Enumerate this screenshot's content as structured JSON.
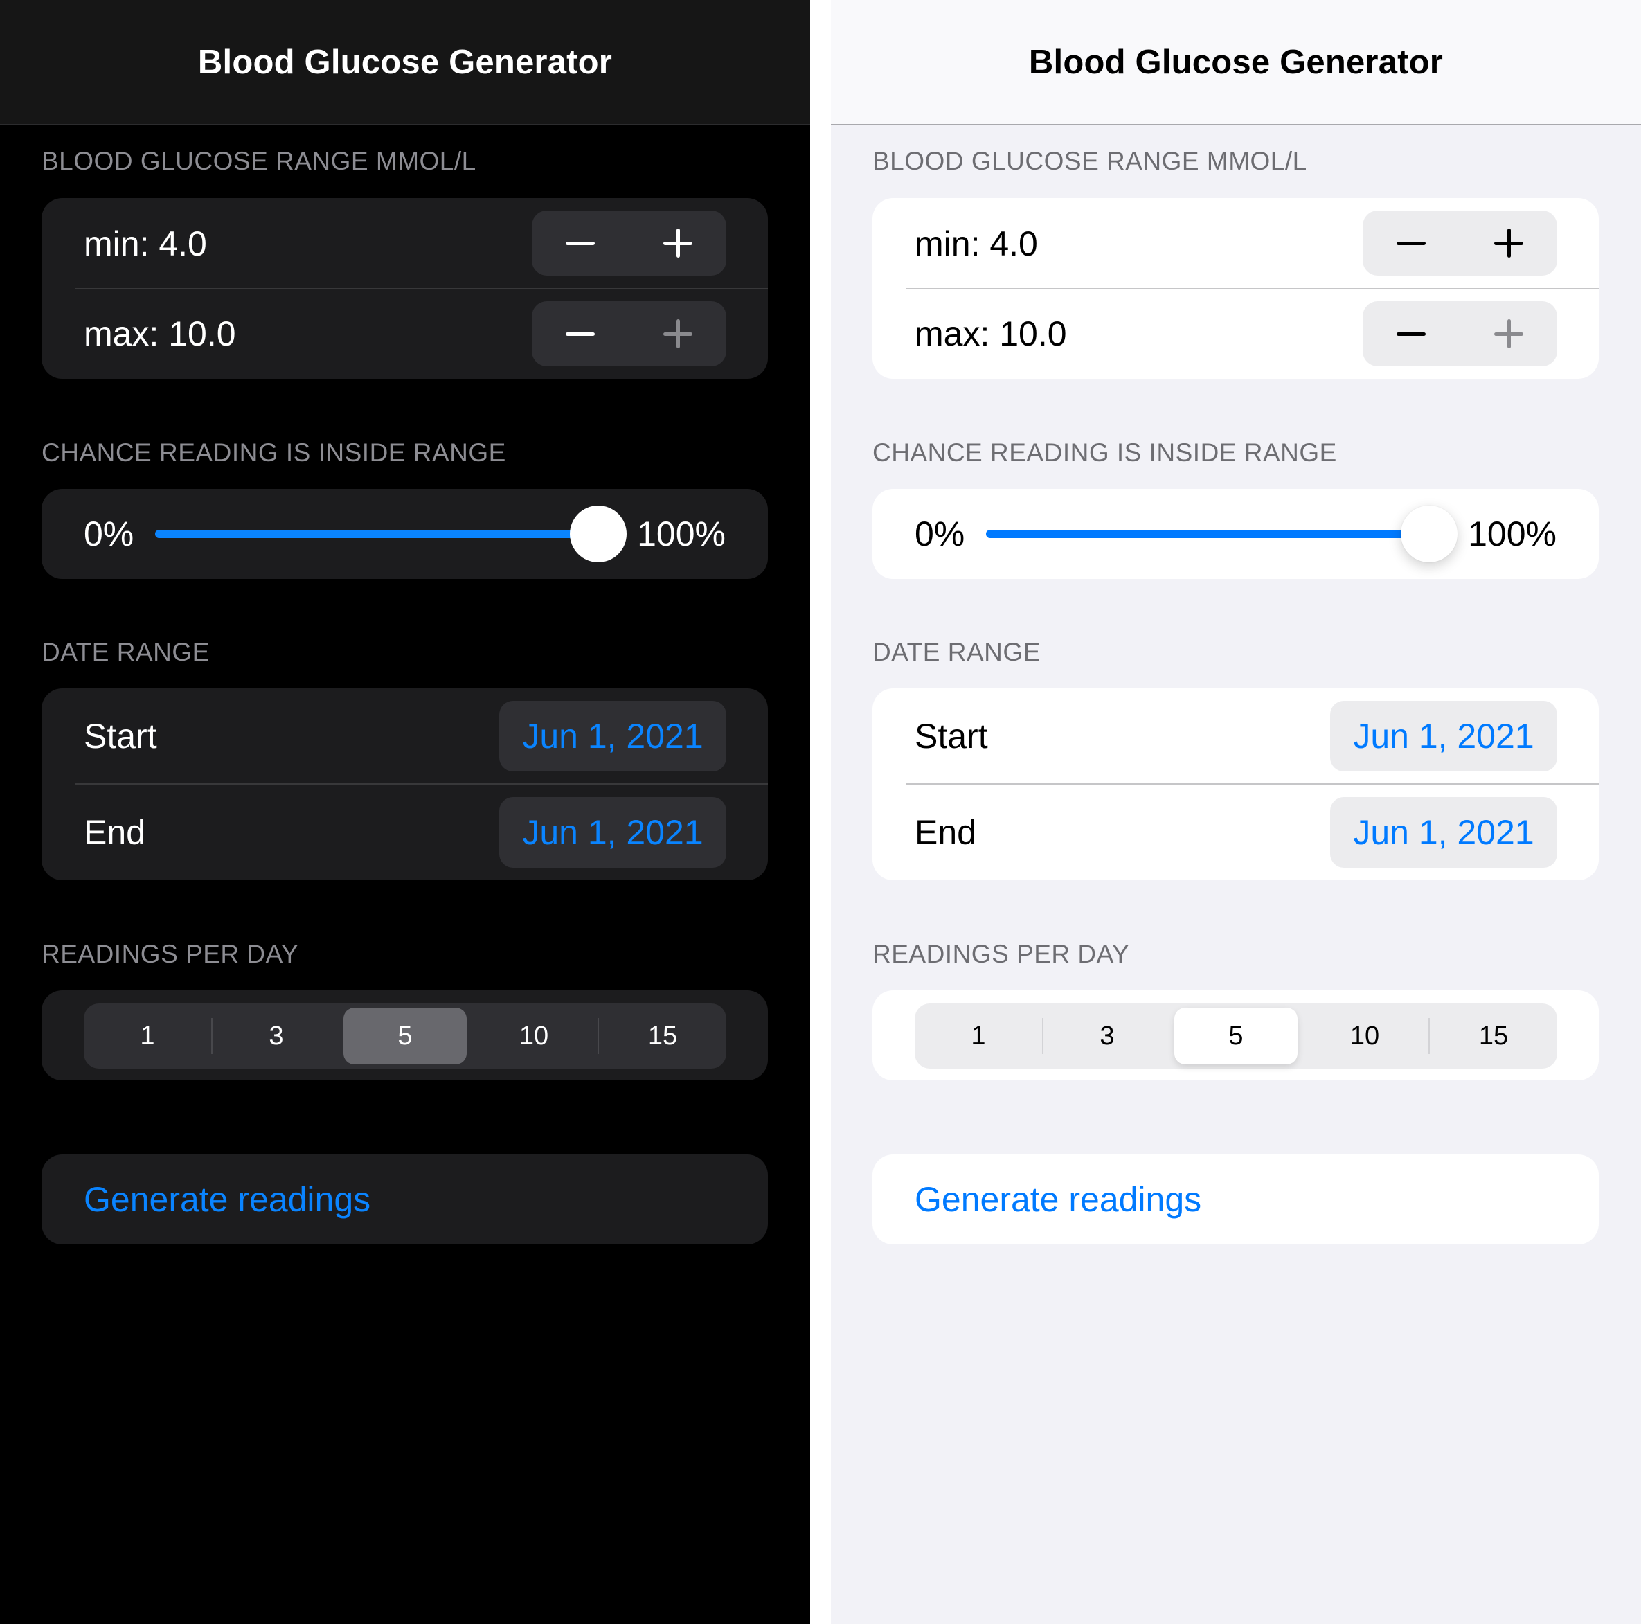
{
  "app": {
    "title": "Blood Glucose Generator"
  },
  "themes": {
    "dark": {
      "background": "#000000",
      "card": "#1c1c1e",
      "accent": "#0a84ff",
      "text": "#ffffff"
    },
    "light": {
      "background": "#f2f2f7",
      "card": "#ffffff",
      "accent": "#007aff",
      "text": "#000000"
    }
  },
  "sections": {
    "glucose_range": {
      "header": "BLOOD GLUCOSE RANGE MMOL/L",
      "min_label": "min: 4.0",
      "max_label": "max: 10.0",
      "min_value": 4.0,
      "max_value": 10.0,
      "decrement_icon": "minus-icon",
      "increment_icon": "plus-icon",
      "max_increment_disabled": true
    },
    "chance": {
      "header": "CHANCE READING IS INSIDE RANGE",
      "min_label": "0%",
      "max_label": "100%",
      "value_percent": 100
    },
    "date_range": {
      "header": "DATE RANGE",
      "start_label": "Start",
      "start_value": "Jun 1, 2021",
      "end_label": "End",
      "end_value": "Jun 1, 2021"
    },
    "readings_per_day": {
      "header": "READINGS PER DAY",
      "options": [
        "1",
        "3",
        "5",
        "10",
        "15"
      ],
      "selected": "5"
    },
    "generate": {
      "label": "Generate readings"
    }
  }
}
